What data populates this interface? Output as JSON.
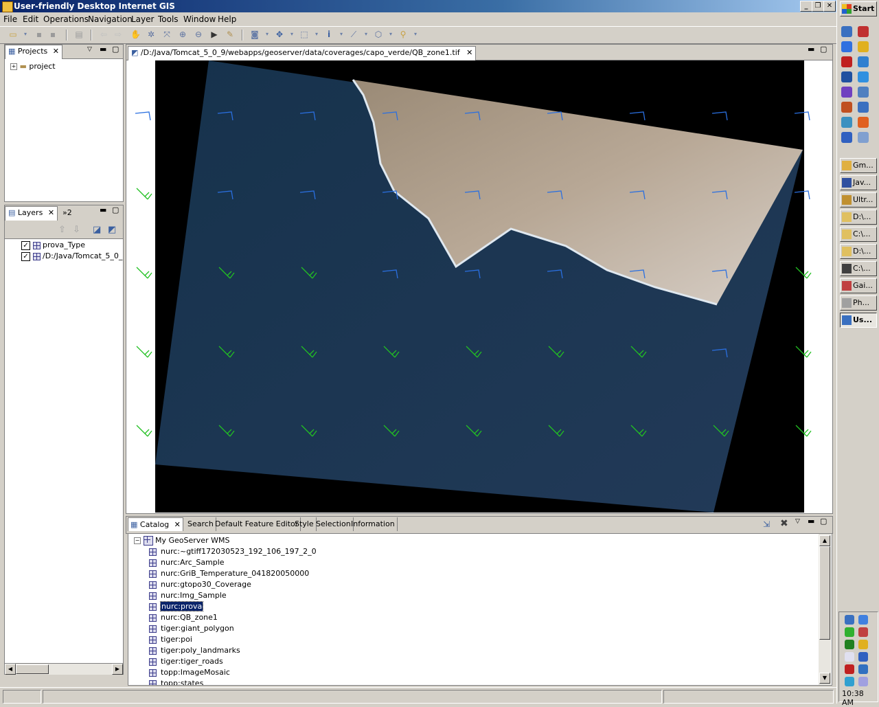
{
  "window": {
    "title": "User-friendly Desktop Internet GIS"
  },
  "menu": [
    "File",
    "Edit",
    "Operations",
    "Navigation",
    "Layer",
    "Tools",
    "Window",
    "Help"
  ],
  "projects": {
    "tab_label": "Projects",
    "items": [
      "project"
    ]
  },
  "layers": {
    "tab_label": "Layers",
    "extra_tab": "»2",
    "items": [
      {
        "label": "prova_Type",
        "checked": true
      },
      {
        "label": "/D:/Java/Tomcat_5_0_",
        "checked": true
      }
    ]
  },
  "map": {
    "tab_label": "/D:/Java/Tomcat_5_0_9/webapps/geoserver/data/coverages/capo_verde/QB_zone1.tif",
    "colors": {
      "ocean": "#1c3550",
      "land": "#a89680",
      "barbs_blue": "#2a6fe0",
      "barbs_green": "#22c022"
    }
  },
  "bottom_tabs": [
    "Catalog",
    "Search",
    "Default Feature Editor",
    "Style",
    "Selection",
    "Information"
  ],
  "catalog": {
    "root": "My GeoServer WMS",
    "items": [
      "nurc:~gtiff172030523_192_106_197_2_0",
      "nurc:Arc_Sample",
      "nurc:GriB_Temperature_041820050000",
      "nurc:gtopo30_Coverage",
      "nurc:Img_Sample",
      "nurc:prova",
      "nurc:QB_zone1",
      "tiger:giant_polygon",
      "tiger:poi",
      "tiger:poly_landmarks",
      "tiger:tiger_roads",
      "topp:ImageMosaic",
      "topp:states"
    ],
    "selected": "nurc:prova"
  },
  "taskbar": {
    "start_label": "Start",
    "buttons": [
      "Gm...",
      "Jav...",
      "Ultr...",
      "D:\\...",
      "C:\\...",
      "D:\\...",
      "C:\\...",
      "Gai...",
      "Ph...",
      "Us..."
    ],
    "clock": "10:38 AM"
  }
}
